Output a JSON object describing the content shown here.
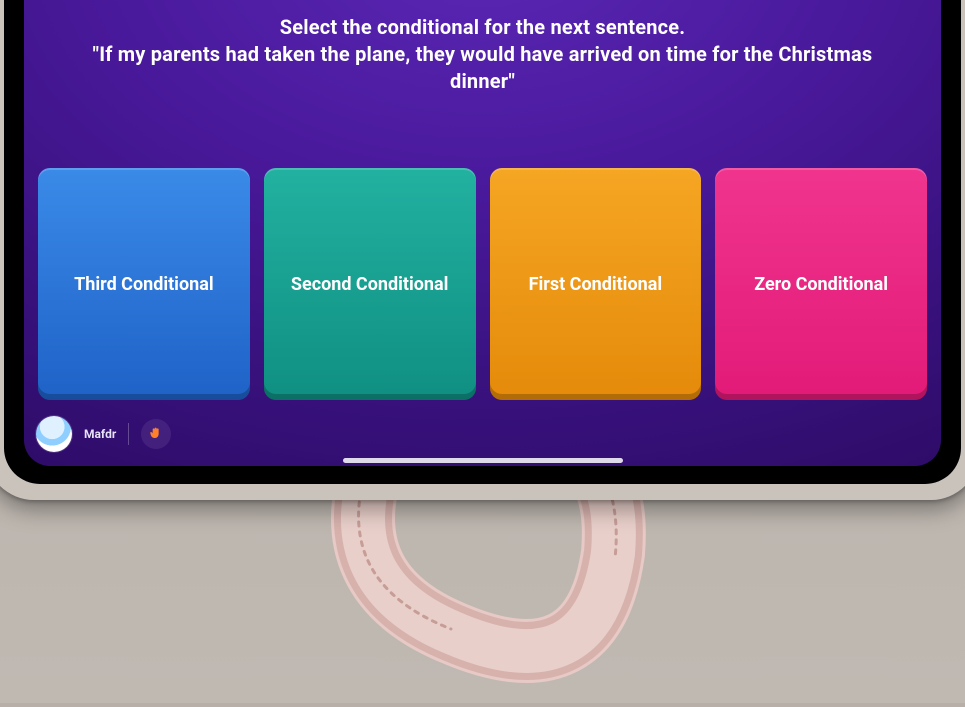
{
  "question": {
    "prompt": "Select the conditional for the next sentence.",
    "sentence": "\"If my parents had taken the plane, they would have arrived on time for the Christmas dinner\""
  },
  "choices": [
    {
      "label": "Third Conditional"
    },
    {
      "label": "Second Conditional"
    },
    {
      "label": "First Conditional"
    },
    {
      "label": "Zero Conditional"
    }
  ],
  "player": {
    "name": "Mafdr"
  },
  "icons": {
    "raise_hand": "raise-hand"
  },
  "colors": {
    "bg_primary": "#3a1280",
    "choice_blue": "#1f62c7",
    "choice_teal": "#0f8f82",
    "choice_orange": "#e58a0a",
    "choice_pink": "#e21a78"
  }
}
